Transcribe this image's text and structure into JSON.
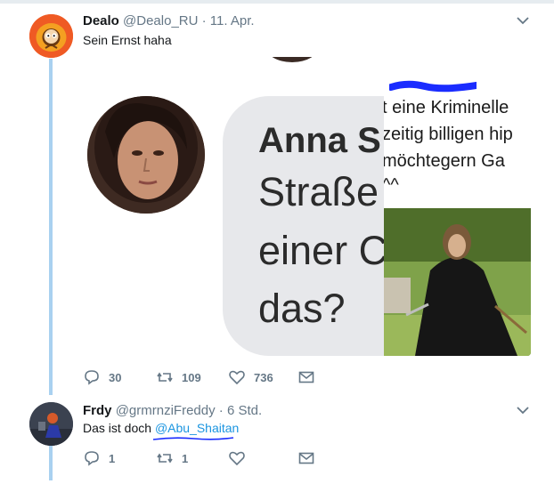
{
  "tweet1": {
    "name": "Dealo",
    "handle": "@Dealo_RU",
    "time": "· 11. Apr.",
    "text": "Sein Ernst haha",
    "media": {
      "bubble_name": "Anna S",
      "bubble_line1": "Straße",
      "bubble_line2": "einer C",
      "bubble_line3": "das?",
      "right_line1": "t eine Kriminelle",
      "right_line2": "zeitig billigen hip",
      "right_line3": "möchtegern Ga",
      "right_line4": "^^"
    },
    "actions": {
      "replies": "30",
      "retweets": "109",
      "likes": "736"
    }
  },
  "tweet2": {
    "name": "Frdy",
    "handle": "@grmrnziFreddy",
    "time": "· 6 Std.",
    "text_prefix": "Das ist doch ",
    "mention": "@Abu_Shaitan",
    "actions": {
      "replies": "1",
      "retweets": "1",
      "likes": ""
    }
  },
  "colors": {
    "accent": "#1b95e0",
    "thread_line": "#a9d1f0",
    "muted": "#657786"
  },
  "icons": [
    "chevron-down-icon",
    "reply-icon",
    "retweet-icon",
    "like-icon",
    "message-icon"
  ]
}
